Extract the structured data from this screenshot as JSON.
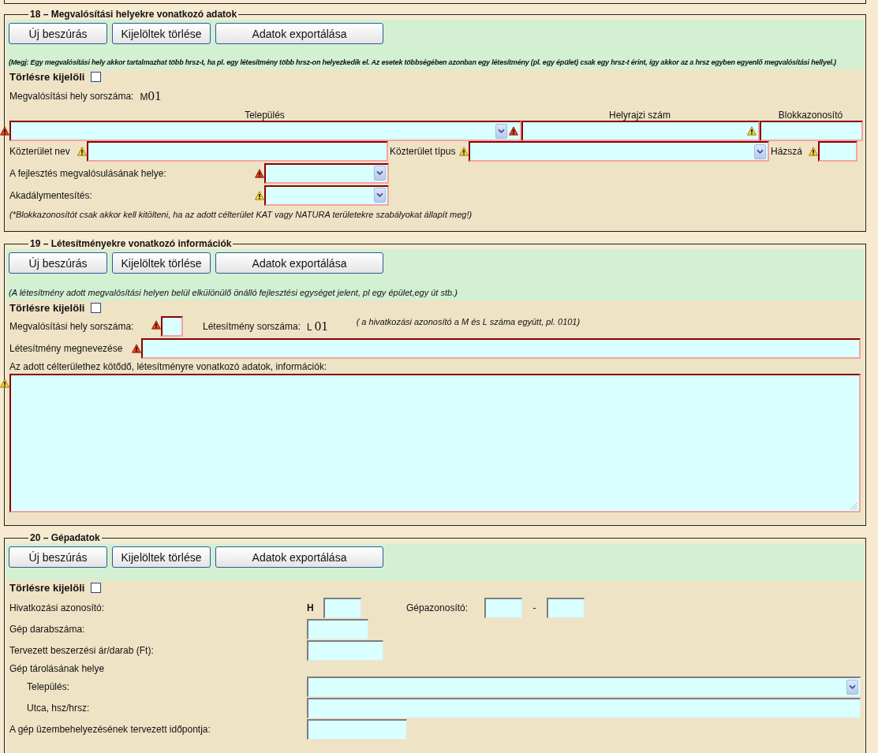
{
  "sections": [
    {
      "kind": "locations",
      "legend": "18 – Megvalósítási helyekre vonatkozó adatok",
      "buttons": [
        "Új beszúrás",
        "Kijelöltek törlése",
        "Adatok exportálása"
      ],
      "note": "(Megj: Egy megvalósítási hely akkor tartalmazhat több hrsz-t, ha pl. egy létesítmény több hrsz-on helyezkedik el. Az esetek többségében azonban egy létesítmény (pl. egy épület) csak egy hrsz-t érint, így akkor az a hrsz egyben egyenlő megvalósítási hellyel.)",
      "delete": {
        "label": "Törlésre kijelöli",
        "checked": false
      },
      "serial": {
        "label": "Megvalósítási hely sorszáma:",
        "prefix": "M",
        "value": "01"
      },
      "address_fields": [
        {
          "heading": "Település",
          "kind": "select",
          "required": true,
          "alert": {
            "severe": true
          },
          "inner_alert": {
            "severe": true
          }
        },
        {
          "heading": "Helyrajzi szám",
          "kind": "input",
          "required": true,
          "inner_alert": {
            "severe": false
          }
        },
        {
          "heading": "Blokkazonosító",
          "kind": "input",
          "required": true
        }
      ],
      "street_fields": [
        {
          "label": "Közterület nev",
          "kind": "input",
          "required": true,
          "alert": {
            "severe": false
          }
        },
        {
          "label": "Közterület típus",
          "kind": "select",
          "required": true,
          "alert": {
            "severe": false
          }
        },
        {
          "label": "Házszá",
          "kind": "input",
          "required": true,
          "alert": {
            "severe": false
          }
        }
      ],
      "rows": [
        {
          "label": "A fejlesztés megvalósulásának helye:",
          "kind": "select",
          "required": true,
          "alert": {
            "severe": true
          }
        },
        {
          "label": "Akadálymentesítés:",
          "kind": "select",
          "required": true,
          "alert": {
            "severe": false
          }
        }
      ],
      "footnote": "(*Blokkazonosítót csak akkor kell kitölteni, ha az adott célterület KAT vagy NATURA területekre szabályokat állapít meg!)"
    },
    {
      "kind": "facilities",
      "legend": "19 – Létesítményekre vonatkozó információk",
      "buttons": [
        "Új beszúrás",
        "Kijelöltek törlése",
        "Adatok exportálása"
      ],
      "note": "(A létesítmény adott megvalósítási helyen belül elkülönülő önálló fejlesztési egységet jelent, pl egy épület,egy út stb.)",
      "delete": {
        "label": "Törlésre kijelöli",
        "checked": false
      },
      "site_serial": {
        "label": "Megvalósítási hely sorszáma:",
        "kind": "input",
        "required": true,
        "alert": {
          "severe": true
        }
      },
      "facility_serial": {
        "label": "Létesítmény sorszáma:",
        "prefix": "L",
        "value": "01"
      },
      "hint": "( a hivatkozási azonosító a M és L száma együtt, pl. 0101)",
      "name_field": {
        "label": "Létesítmény megnevezése",
        "kind": "input",
        "required": true,
        "alert": {
          "severe": true
        }
      },
      "details": {
        "label": "Az adott célterülethez kötődő, létesítményre vonatkozó adatok, információk:",
        "kind": "textarea",
        "required": true,
        "alert": {
          "severe": false
        }
      }
    },
    {
      "kind": "machines",
      "legend": "20 – Gépadatok",
      "buttons": [
        "Új beszúrás",
        "Kijelöltek törlése",
        "Adatok exportálása"
      ],
      "delete": {
        "label": "Törlésre kijelöli",
        "checked": false
      },
      "rows": [
        {
          "kind": "id",
          "label": "Hivatkozási azonosító:",
          "prefix": "H",
          "second_label": "Gépazonosító:",
          "separator": "-",
          "fields": [
            {
              "kind": "input",
              "required": false
            },
            {
              "kind": "input",
              "required": false
            },
            {
              "kind": "input",
              "required": false
            }
          ]
        },
        {
          "kind": "field",
          "label": "Gép darabszáma:",
          "field": {
            "kind": "input",
            "required": false
          }
        },
        {
          "kind": "field",
          "label": "Tervezett beszerzési ár/darab (Ft):",
          "field": {
            "kind": "input",
            "required": false
          }
        },
        {
          "kind": "heading",
          "label": "Gép tárolásának helye"
        },
        {
          "kind": "sub",
          "label": "Település:",
          "field": {
            "kind": "select",
            "required": false
          }
        },
        {
          "kind": "sub",
          "label": "Utca, hsz/hrsz:",
          "field": {
            "kind": "input",
            "required": false
          }
        },
        {
          "kind": "field",
          "label": "A gép üzembehelyezésének tervezett időpontja:",
          "field": {
            "kind": "input",
            "required": false
          }
        }
      ]
    }
  ]
}
